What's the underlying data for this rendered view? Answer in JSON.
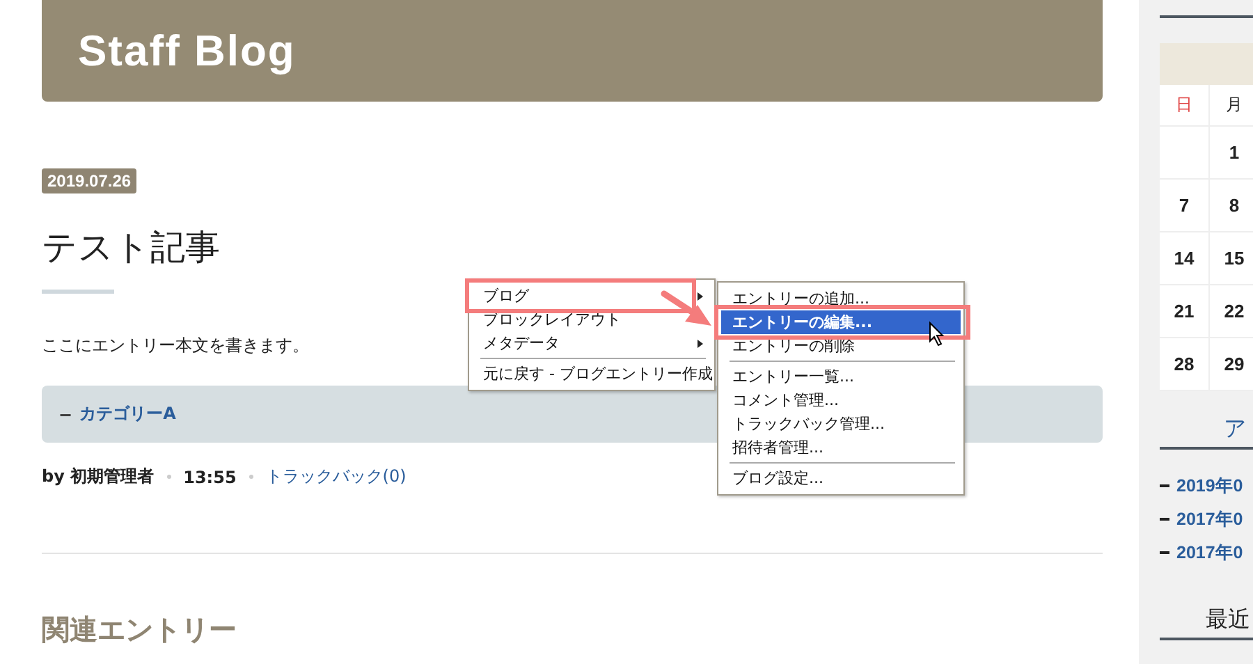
{
  "header": {
    "title": "Staff Blog"
  },
  "entry": {
    "date": "2019.07.26",
    "title": "テスト記事",
    "body": "ここにエントリー本文を書きます。",
    "category": {
      "bullet": "−",
      "label": "カテゴリーA"
    },
    "meta": [
      {
        "kind": "text",
        "text": "by 初期管理者"
      },
      {
        "kind": "text",
        "text": "13:55"
      },
      {
        "kind": "link",
        "text": "トラックバック(0)"
      }
    ]
  },
  "related": {
    "title": "関連エントリー"
  },
  "context_menu": {
    "items": [
      {
        "kind": "item",
        "label": "ブログ",
        "has_submenu": true,
        "selected": false,
        "highlighted": true
      },
      {
        "kind": "item",
        "label": "ブロックレイアウト",
        "has_submenu": false,
        "selected": false,
        "highlighted": false
      },
      {
        "kind": "item",
        "label": "メタデータ",
        "has_submenu": true,
        "selected": false,
        "highlighted": false
      },
      {
        "kind": "separator"
      },
      {
        "kind": "item",
        "label": "元に戻す - ブログエントリー作成",
        "has_submenu": false,
        "selected": false,
        "highlighted": false
      }
    ]
  },
  "submenu": {
    "items": [
      {
        "kind": "item",
        "label": "エントリーの追加...",
        "selected": false,
        "highlighted": false
      },
      {
        "kind": "item",
        "label": "エントリーの編集...",
        "selected": true,
        "highlighted": true
      },
      {
        "kind": "item",
        "label": "エントリーの削除",
        "selected": false,
        "highlighted": false
      },
      {
        "kind": "separator"
      },
      {
        "kind": "item",
        "label": "エントリー一覧...",
        "selected": false,
        "highlighted": false
      },
      {
        "kind": "item",
        "label": "コメント管理...",
        "selected": false,
        "highlighted": false
      },
      {
        "kind": "item",
        "label": "トラックバック管理...",
        "selected": false,
        "highlighted": false
      },
      {
        "kind": "item",
        "label": "招待者管理...",
        "selected": false,
        "highlighted": false
      },
      {
        "kind": "separator"
      },
      {
        "kind": "item",
        "label": "ブログ設定...",
        "selected": false,
        "highlighted": false
      }
    ]
  },
  "sidebar": {
    "calendar": {
      "weekdays": [
        {
          "label": "日",
          "kind": "sunday"
        },
        {
          "label": "月",
          "kind": "weekday"
        }
      ],
      "weeks": [
        [
          {
            "kind": "blank"
          },
          {
            "kind": "day",
            "label": "1"
          }
        ],
        [
          {
            "kind": "day",
            "label": "7"
          },
          {
            "kind": "day",
            "label": "8"
          }
        ],
        [
          {
            "kind": "day",
            "label": "14"
          },
          {
            "kind": "day",
            "label": "15"
          }
        ],
        [
          {
            "kind": "day",
            "label": "21"
          },
          {
            "kind": "day",
            "label": "22"
          }
        ],
        [
          {
            "kind": "day",
            "label": "28"
          },
          {
            "kind": "day",
            "label": "29"
          }
        ]
      ]
    },
    "archive": {
      "title": "ア",
      "links": [
        "2019年0",
        "2017年0",
        "2017年0"
      ]
    },
    "recent": {
      "title": "最近"
    }
  }
}
